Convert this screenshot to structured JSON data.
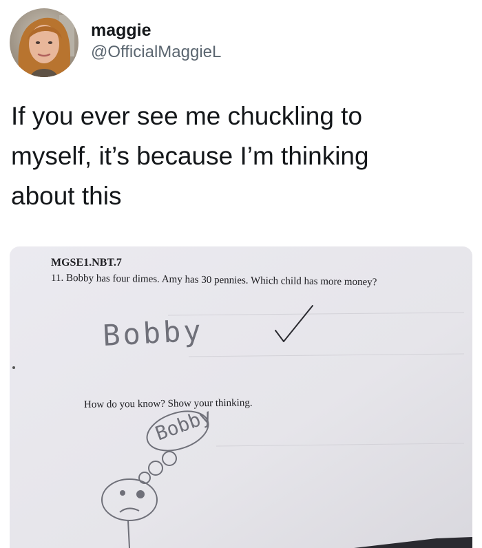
{
  "tweet": {
    "display_name": "maggie",
    "handle": "@OfficialMaggieL",
    "text": "If you ever see me chuckling to\nmyself, it’s because I’m thinking\nabout this",
    "avatar_icon": "profile-photo-woman"
  },
  "worksheet": {
    "standard_code": "MGSE1.NBT.7",
    "question_number": "11.",
    "question_text": "Bobby has four dimes. Amy has 30 pennies. Which child has more money?",
    "handwritten_answer": "Bobby",
    "check_icon": "checkmark-icon",
    "followup_prompt": "How do you know? Show your thinking.",
    "drawing_label": "Bobby"
  },
  "colors": {
    "paper": "#e9e8ed",
    "ink": "#1e1e22",
    "pencil": "#6f7079",
    "handle_gray": "#5b6670"
  }
}
